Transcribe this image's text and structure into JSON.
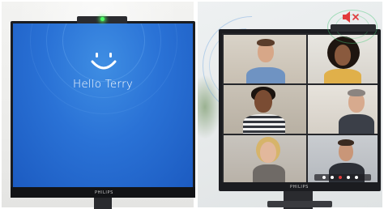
{
  "left_monitor": {
    "greeting": "Hello Terry",
    "brand": "PHILIPS",
    "camera_led_color": "#4cff66",
    "screen_color": "#2a72d6"
  },
  "right_monitor": {
    "brand": "PHILIPS",
    "participants": [
      "man-light-blue-shirt",
      "woman-curly-hair",
      "woman-striped-top",
      "man-grey-hair",
      "woman-blonde-hair",
      "man-dark-shirt"
    ],
    "status_icon": "speaker-muted-icon",
    "status_color": "#e23b3b"
  }
}
